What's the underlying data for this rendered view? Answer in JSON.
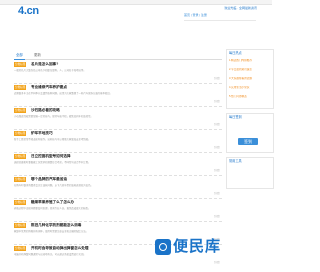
{
  "header": {
    "logo_text": "4.cn",
    "top_note": "欢迎光临 · 全网最新资讯",
    "toolbar_text": "首页 | 登录 | 注册"
  },
  "main": {
    "tabs": [
      {
        "label": "全部"
      },
      {
        "label": "更新"
      }
    ],
    "articles": [
      {
        "badge": "分类标签",
        "title": "名片是怎么回事?",
        "excerpt": "一般的名片大致包括公司名字和职位职称，人，公司名字和地址等。",
        "meta": "[详情]"
      },
      {
        "badge": "分类标签",
        "title": "专业维修汽车养护要点",
        "excerpt": "近期很多车主在不同季节会遇到各种问题，这里为大家整理了一些汽车保养方面的基本知识。",
        "meta": "[详情]"
      },
      {
        "badge": "分类标签",
        "title": "沙石路必看的攻略",
        "excerpt": "沙石路面驾驶需要掌握一定的技巧，保持车速平稳，避免急刹车和急转弯。",
        "meta": "[详情]"
      },
      {
        "badge": "分类标签",
        "title": "炉车平地技巧",
        "excerpt": "新手上路常常不知道如何操作，这些技巧可以帮助大家更加安全地驾驶。",
        "meta": "[详情]"
      },
      {
        "badge": "分类标签",
        "title": "日立挖掘机型号如何选择",
        "excerpt": "选择挖掘机时要根据工况需求和预算综合考虑，不同型号适合不同工程。",
        "meta": "[详情]"
      },
      {
        "badge": "分类标签",
        "title": "哪个品牌的汽车最省油",
        "excerpt": "在购车时很多消费者会关注油耗问题，以下几款车型的油耗表现较为出色。",
        "meta": "[详情]"
      },
      {
        "badge": "分类标签",
        "title": "糖果苹果养殖了么了怎么办",
        "excerpt": "养殖过程中出现问题要及时处理，咨询专业人员，避免造成更大的损失。",
        "meta": "[详情]"
      },
      {
        "badge": "分类标签",
        "title": "陈旧几种化学药剂都能怎么消毒",
        "excerpt": "家庭中常用的消毒剂有多种，使用时需要注意安全和正确的配比方法。",
        "meta": "[详情]"
      },
      {
        "badge": "分类标签",
        "title": "开机时会导致自动弹出弹窗怎么处理",
        "excerpt": "电脑开机弹窗问题通常与启动项有关，可以通过系统设置进行关闭。",
        "meta": "[详情]"
      }
    ]
  },
  "sidebar": {
    "hot_title": "每日热点",
    "hot_items": [
      "1.精选热门内容推荐",
      "2.今日最新资讯速览",
      "3.大家都在看的话题",
      "4.实用生活小常识",
      "5.热门问答精选"
    ],
    "sign_title": "每日签到",
    "sign_button": "签到",
    "tools_title": "常用工具"
  },
  "watermark": {
    "text": "便民库"
  },
  "colors": {
    "brand": "#1a73c8",
    "badge": "#f2a31a",
    "hot_item": "#f08a1a"
  }
}
